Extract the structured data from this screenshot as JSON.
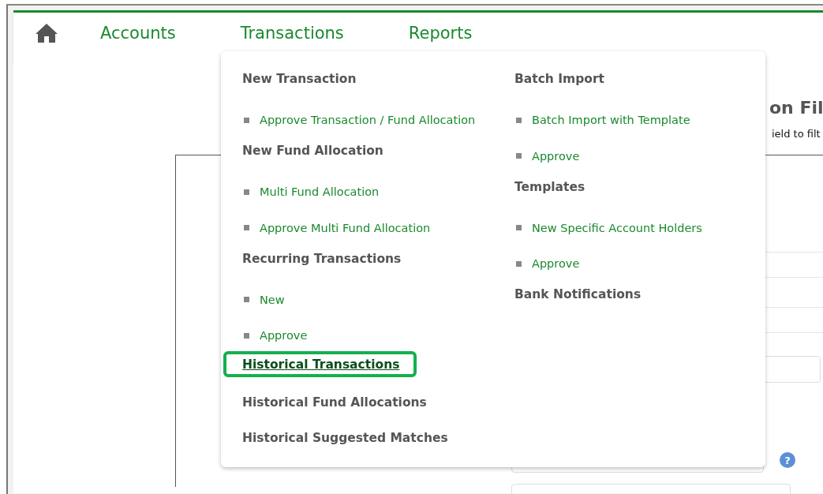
{
  "nav": {
    "items": [
      {
        "label": "Accounts"
      },
      {
        "label": "Transactions"
      },
      {
        "label": "Reports"
      }
    ]
  },
  "page": {
    "heading": "on Fil",
    "hint": "ield to filt",
    "help": "?"
  },
  "menu": {
    "columns": [
      {
        "items": [
          {
            "kind": "heading",
            "label": "New Transaction",
            "selected": false
          },
          {
            "kind": "link",
            "label": "Approve Transaction / Fund Allocation",
            "selected": false
          },
          {
            "kind": "heading",
            "label": "New Fund Allocation",
            "selected": false
          },
          {
            "kind": "link",
            "label": "Multi Fund Allocation",
            "selected": false
          },
          {
            "kind": "link",
            "label": "Approve Multi Fund Allocation",
            "selected": false
          },
          {
            "kind": "heading",
            "label": "Recurring Transactions",
            "selected": false
          },
          {
            "kind": "link",
            "label": "New",
            "selected": false
          },
          {
            "kind": "link",
            "label": "Approve",
            "selected": false
          },
          {
            "kind": "heading",
            "label": "Historical Transactions",
            "selected": true
          },
          {
            "kind": "heading",
            "label": "Historical Fund Allocations",
            "selected": false
          },
          {
            "kind": "heading",
            "label": "Historical Suggested Matches",
            "selected": false
          }
        ]
      },
      {
        "items": [
          {
            "kind": "heading",
            "label": "Batch Import",
            "selected": false
          },
          {
            "kind": "link",
            "label": "Batch Import with Template",
            "selected": false
          },
          {
            "kind": "link",
            "label": "Approve",
            "selected": false
          },
          {
            "kind": "heading",
            "label": "Templates",
            "selected": false
          },
          {
            "kind": "link",
            "label": "New Specific Account Holders",
            "selected": false
          },
          {
            "kind": "link",
            "label": "Approve",
            "selected": false
          },
          {
            "kind": "heading",
            "label": "Bank Notifications",
            "selected": false
          }
        ]
      }
    ]
  }
}
